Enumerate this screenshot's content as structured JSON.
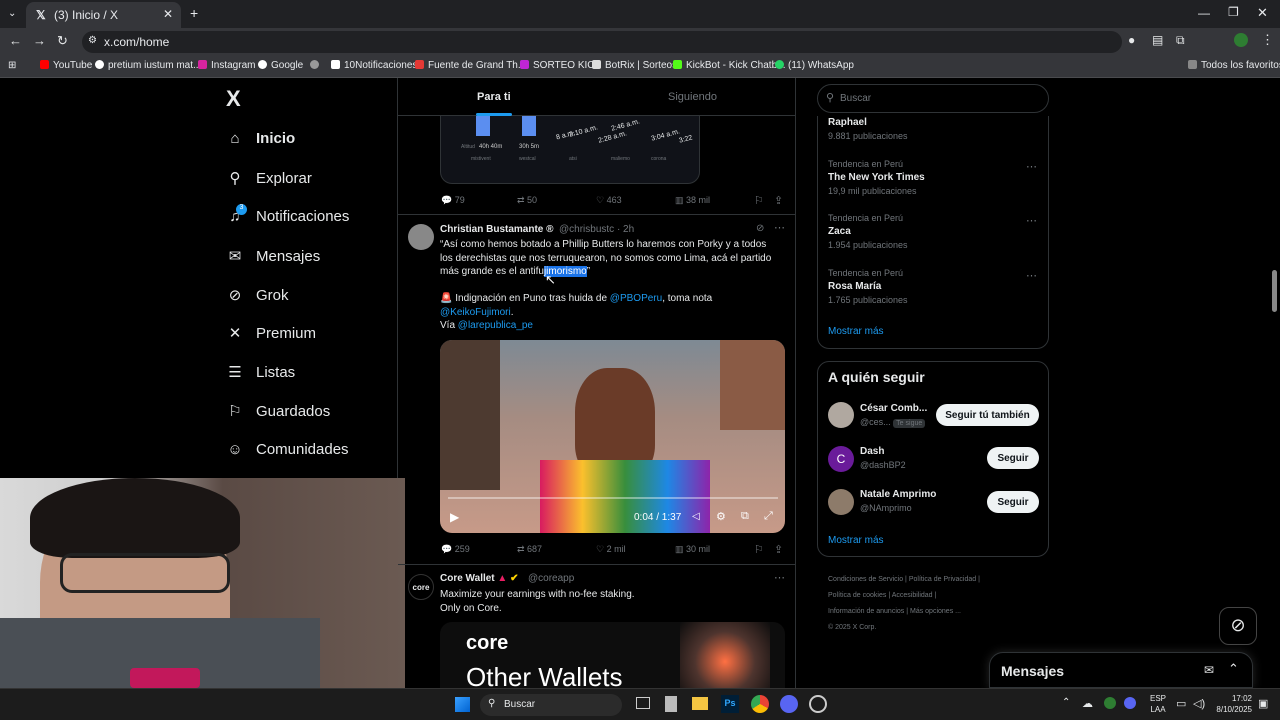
{
  "browser": {
    "tab_title": "(3) Inicio / X",
    "url": "x.com/home",
    "bookmarks": [
      "YouTube",
      "pretium iustum mat...",
      "Instagram",
      "Google",
      "10Notificaciones",
      "Fuente de Grand Th...",
      "SORTEO KICK",
      "BotRix | Sorteos",
      "KickBot - Kick Chatb...",
      "(11) WhatsApp"
    ],
    "all_bookmarks": "Todos los favoritos"
  },
  "sidebar": {
    "logo": "X",
    "items": [
      {
        "label": "Inicio",
        "icon": "home-icon"
      },
      {
        "label": "Explorar",
        "icon": "search-icon"
      },
      {
        "label": "Notificaciones",
        "icon": "bell-icon",
        "badge": "3"
      },
      {
        "label": "Mensajes",
        "icon": "mail-icon"
      },
      {
        "label": "Grok",
        "icon": "grok-icon"
      },
      {
        "label": "Premium",
        "icon": "x-icon"
      },
      {
        "label": "Listas",
        "icon": "list-icon"
      },
      {
        "label": "Guardados",
        "icon": "bookmark-icon"
      },
      {
        "label": "Comunidades",
        "icon": "people-icon"
      }
    ]
  },
  "feed": {
    "tabs": [
      "Para ti",
      "Siguiendo"
    ],
    "chart_ticks": [
      "8 a.m.",
      "2:10 a.m.",
      "2:28 a.m.",
      "2:46 a.m.",
      "3:04 a.m.",
      "3:22"
    ],
    "chart_labels": [
      "Altitud",
      "40h 40m",
      "30h 5m",
      "mistivent",
      "westcal",
      "atsi",
      "maliemo",
      "corona"
    ],
    "tweet0": {
      "replies": "79",
      "retweets": "50",
      "likes": "463",
      "views": "38 mil"
    },
    "tweet1": {
      "name": "Christian Bustamante",
      "handle": "@chrisbustc · 2h",
      "text_line1": "“Así como hemos botado a Phillip Butters lo haremos con Porky y a todos",
      "text_line2": "los derechistas que nos terruquearon, no somos como Lima, acá el partido",
      "text_line3_a": "más grande es el antifu",
      "text_line3_b": "jimorismo",
      "text_line3_c": "”",
      "line4_a": "🚨 Indignación en Puno tras huida de ",
      "line4_mention": "@PBOPeru",
      "line4_b": ", toma nota",
      "line5": "@KeikoFujimori",
      "line5_end": ".",
      "line6_a": "Vía ",
      "line6_mention": "@larepublica_pe",
      "video_time": "0:04 / 1:37",
      "replies": "259",
      "retweets": "687",
      "likes": "2 mil",
      "views": "30 mil"
    },
    "tweet2": {
      "name": "Core Wallet",
      "handle": "@coreapp",
      "line1": "Maximize your earnings with no-fee staking.",
      "line2": "Only on Core.",
      "brand": "core",
      "headline": "Other Wallets"
    }
  },
  "right": {
    "search_placeholder": "Buscar",
    "trends": [
      {
        "meta": "",
        "name": "Raphael",
        "count": "9.881 publicaciones"
      },
      {
        "meta": "Tendencia en Perú",
        "name": "The New York Times",
        "count": "19,9 mil publicaciones"
      },
      {
        "meta": "Tendencia en Perú",
        "name": "Zaca",
        "count": "1.954 publicaciones"
      },
      {
        "meta": "Tendencia en Perú",
        "name": "Rosa María",
        "count": "1.765 publicaciones"
      }
    ],
    "show_more": "Mostrar más",
    "who_to_follow": "A quién seguir",
    "follow": [
      {
        "name": "César Comb...",
        "handle": "@ces...",
        "badge": "Te sigue",
        "button": "Seguir tú también"
      },
      {
        "name": "Dash",
        "handle": "@dashBP2",
        "button": "Seguir"
      },
      {
        "name": "Natale Amprimo",
        "handle": "@NAmprimo",
        "button": "Seguir"
      }
    ],
    "show_more2": "Mostrar más",
    "footer": [
      "Condiciones de Servicio",
      "Política de Privacidad",
      "Política de cookies",
      "Accesibilidad",
      "Información de anuncios",
      "Más opciones ...",
      "© 2025 X Corp."
    ],
    "messages": "Mensajes"
  },
  "taskbar": {
    "search": "Buscar",
    "lang1": "ESP",
    "lang2": "LAA",
    "time": "17:02",
    "date": "8/10/2025"
  }
}
